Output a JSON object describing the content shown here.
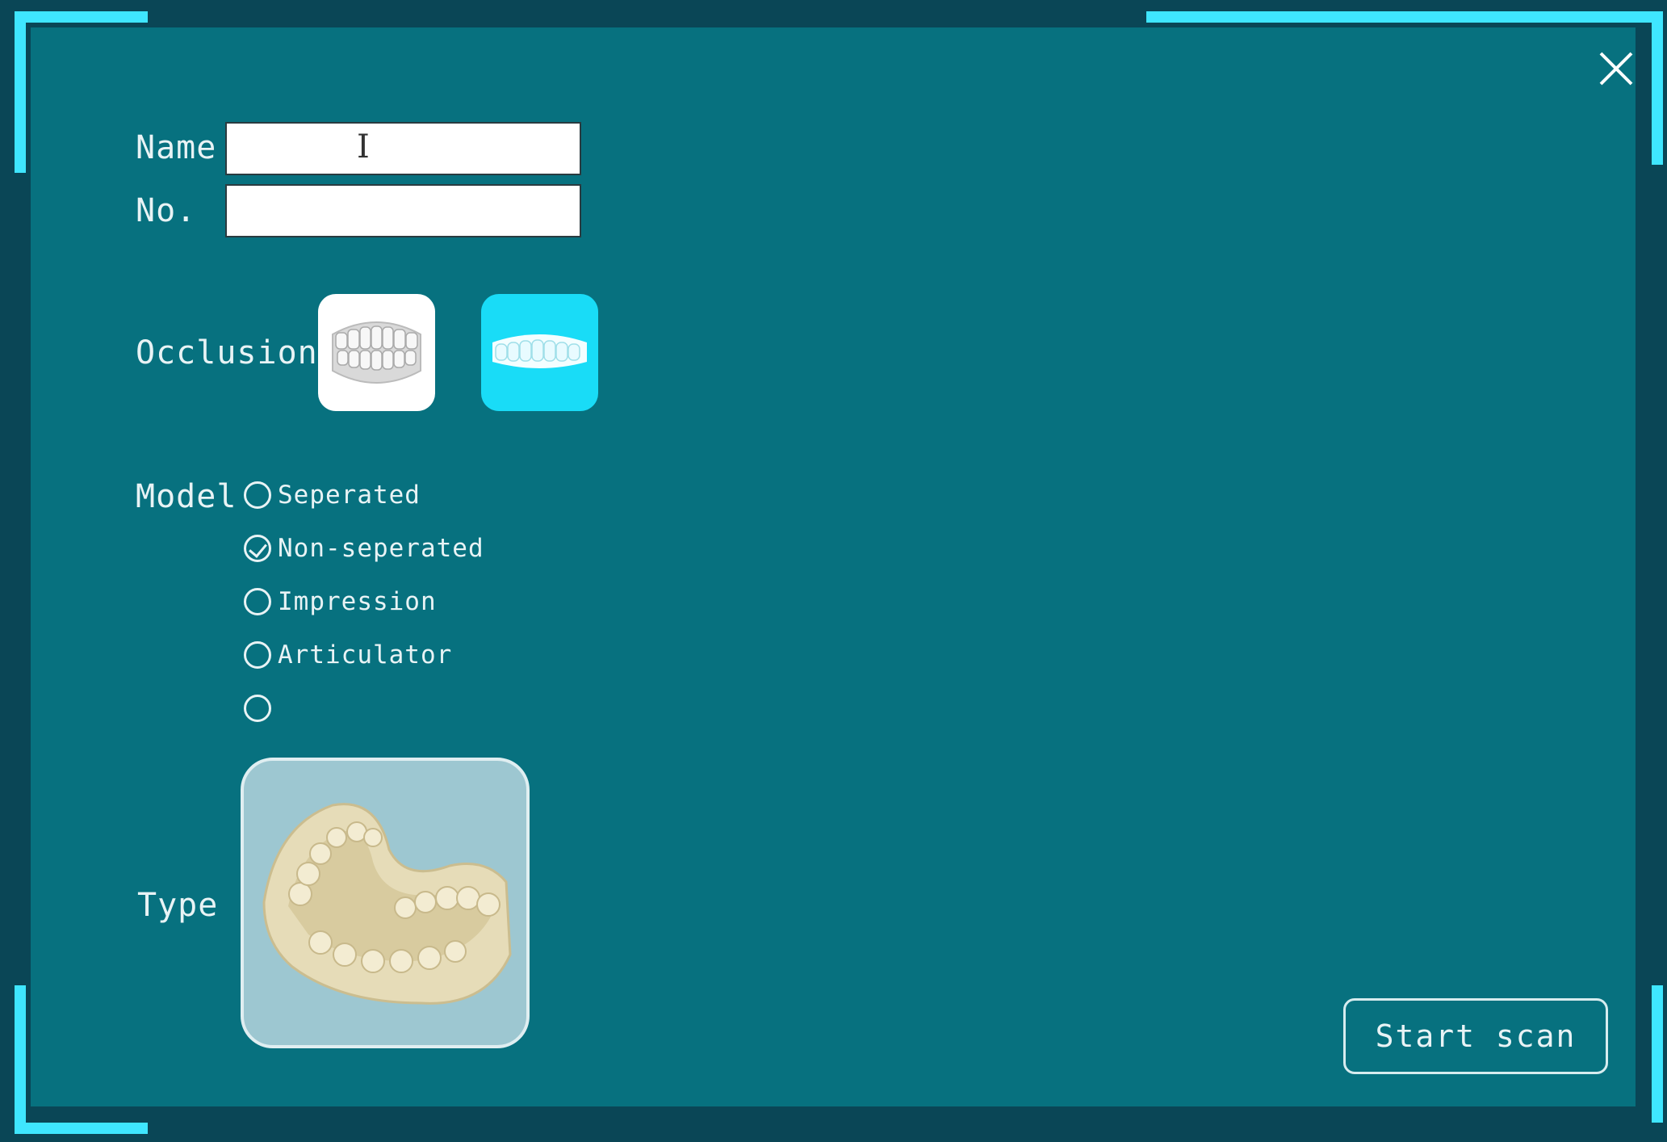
{
  "form": {
    "name_label": "Name",
    "name_value": "",
    "no_label": "No.",
    "no_value": "",
    "occlusion_label": "Occlusion",
    "model_label": "Model",
    "type_label": "Type"
  },
  "model_options": [
    {
      "label": "Seperated",
      "selected": false
    },
    {
      "label": "Non-seperated",
      "selected": true
    },
    {
      "label": "Impression",
      "selected": false
    },
    {
      "label": "Articulator",
      "selected": false
    },
    {
      "label": "",
      "selected": false
    }
  ],
  "occlusion_options": [
    {
      "icon": "teeth-occlusion-icon",
      "selected": false
    },
    {
      "icon": "teeth-bite-icon",
      "selected": true
    }
  ],
  "actions": {
    "start_scan": "Start scan",
    "close_icon": "close-icon"
  },
  "colors": {
    "panel": "#07717f",
    "accent": "#3fe6ff",
    "selected_occlusion": "#19dcf7"
  }
}
